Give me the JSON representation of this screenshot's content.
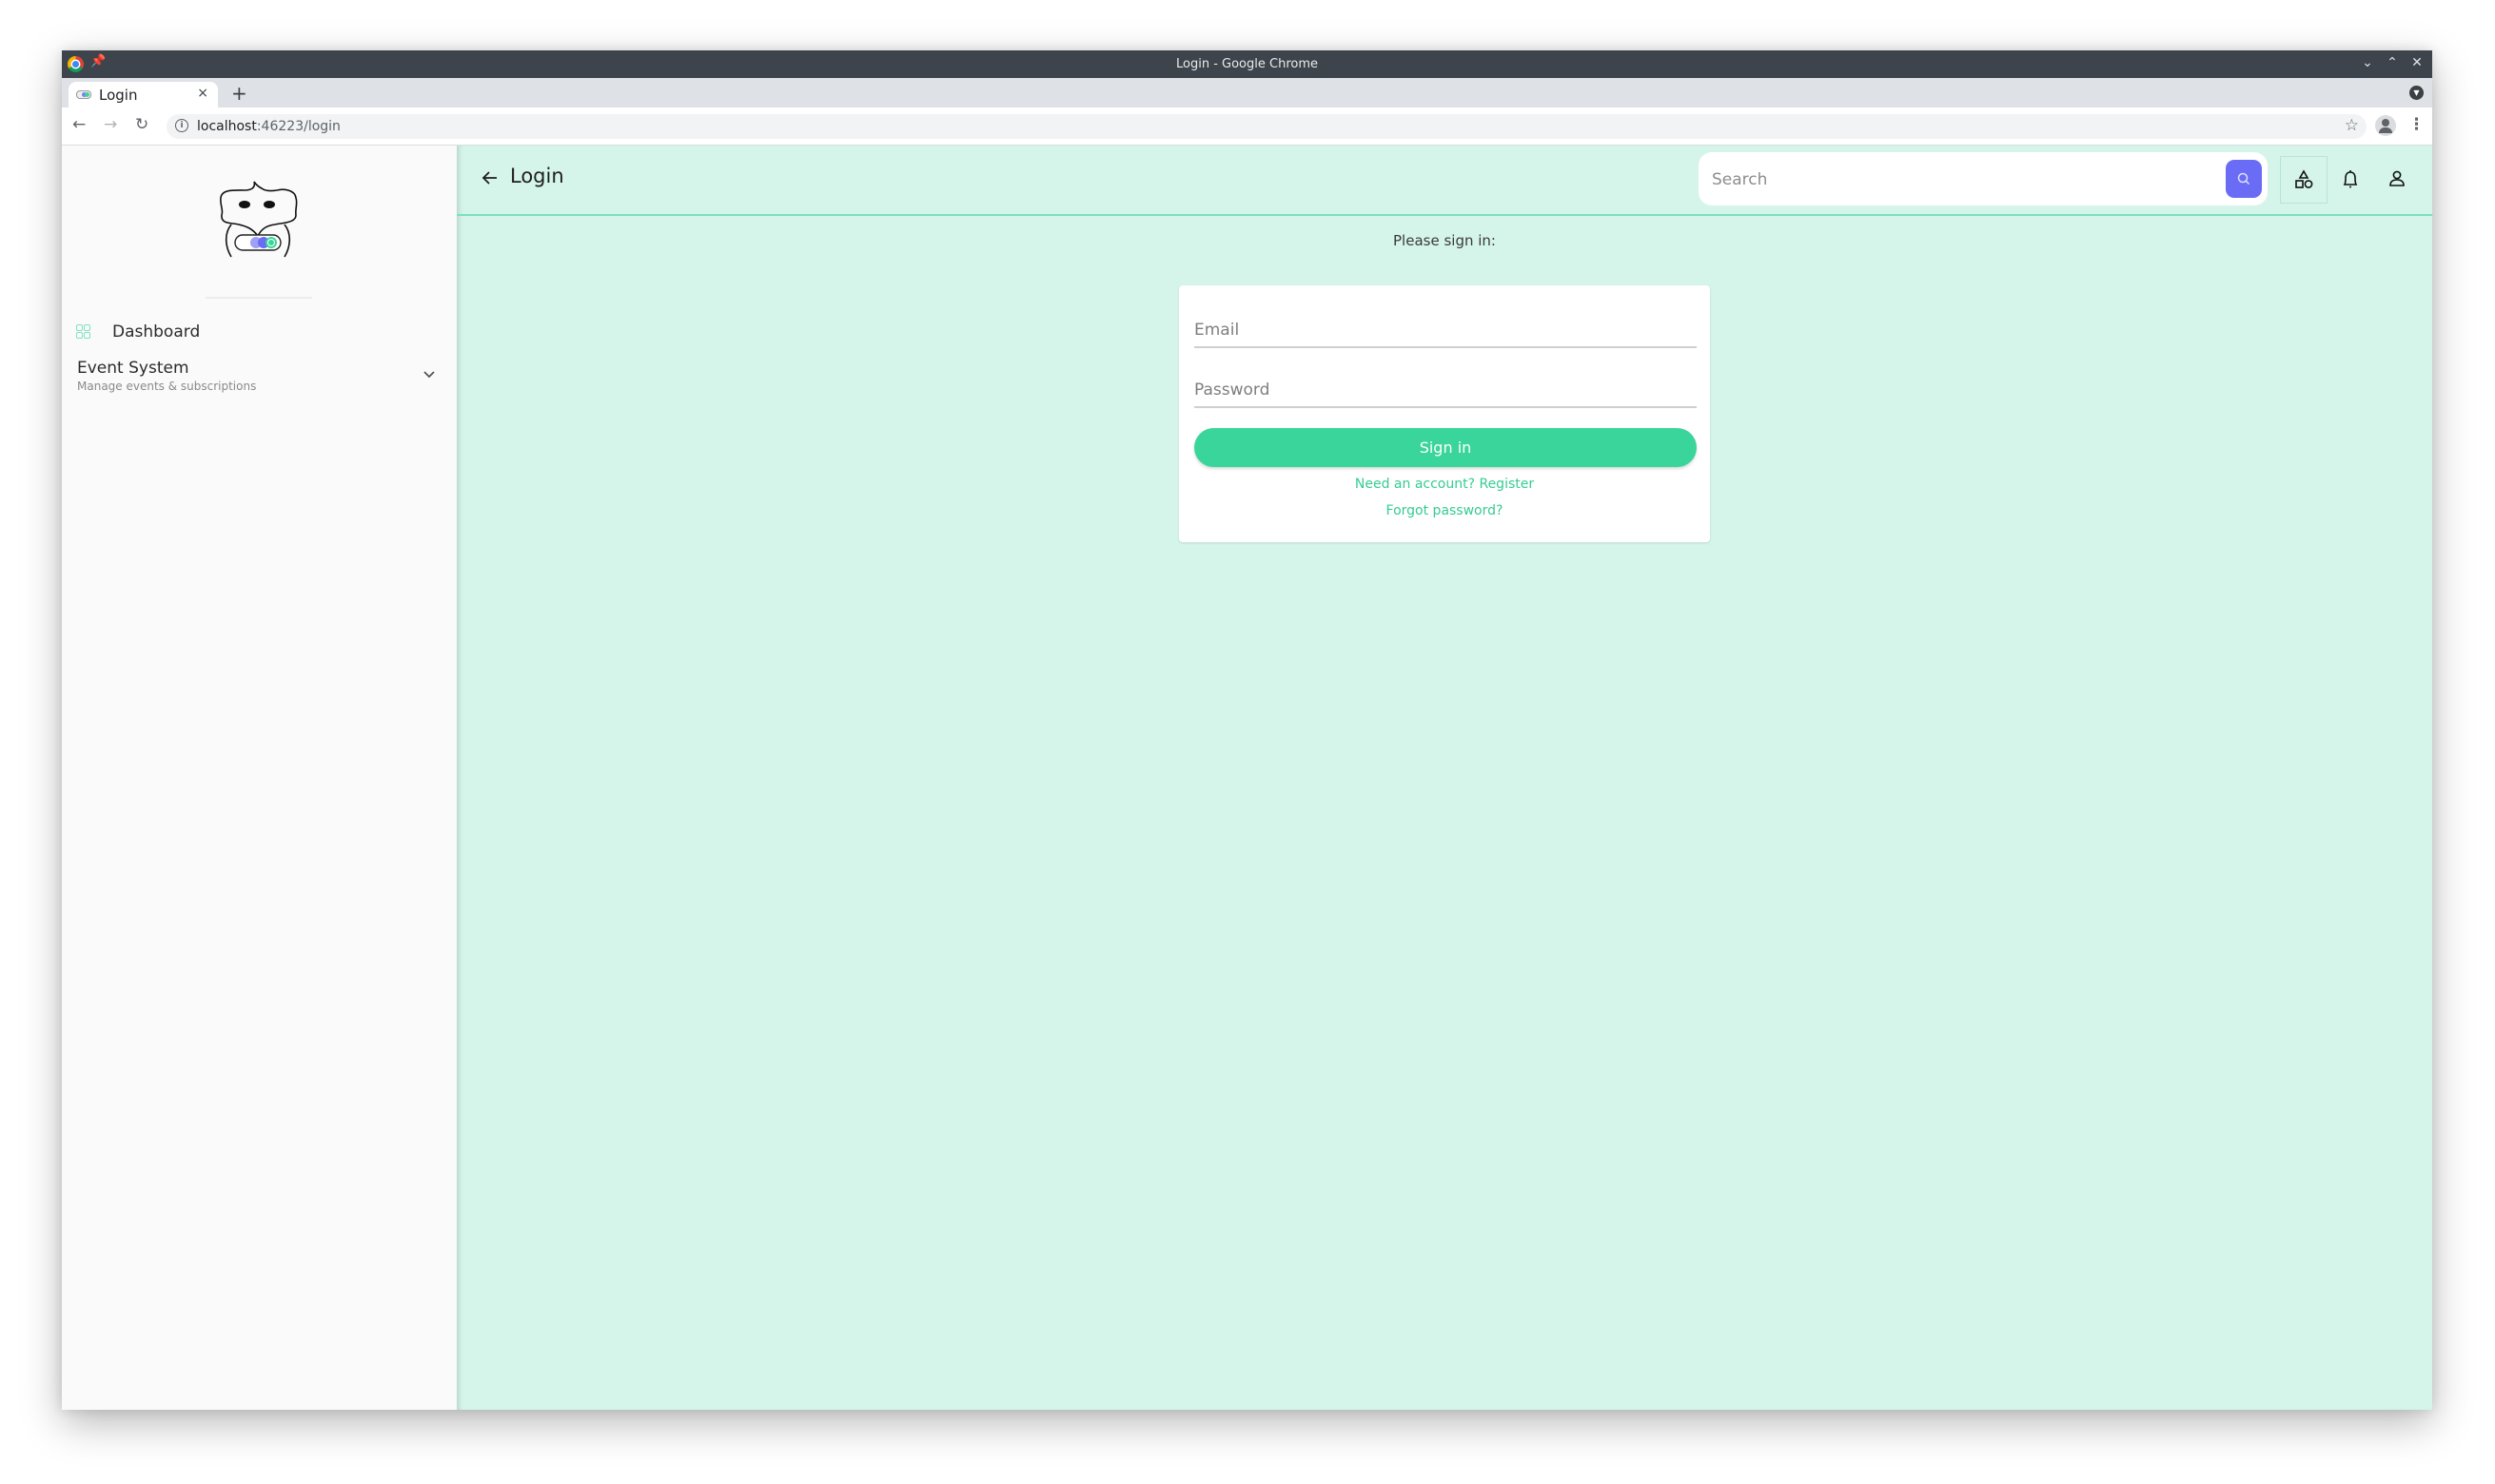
{
  "browser": {
    "window_title": "Login - Google Chrome",
    "tab": {
      "title": "Login",
      "close_glyph": "×"
    },
    "new_tab_glyph": "+",
    "address": {
      "host": "localhost",
      "path": ":46223/login"
    },
    "icons": {
      "back": "←",
      "forward": "→",
      "reload": "↻",
      "info": "i",
      "star": "☆",
      "menu": "⋮",
      "pin": "✈",
      "minimize": "⌄",
      "maximize": "⌃",
      "close": "✕",
      "tab_search": "▼"
    }
  },
  "sidebar": {
    "items": [
      {
        "label": "Dashboard",
        "icon": "grid-icon"
      },
      {
        "label": "Event System",
        "subtitle": "Manage events & subscriptions",
        "icon": "chevron-down-icon"
      }
    ]
  },
  "header": {
    "title": "Login",
    "search": {
      "placeholder": "Search",
      "value": ""
    }
  },
  "login": {
    "prompt": "Please sign in:",
    "email_placeholder": "Email",
    "password_placeholder": "Password",
    "signin_label": "Sign in",
    "register_link": "Need an account? Register",
    "forgot_link": "Forgot password?"
  },
  "colors": {
    "accent": "#3ad59a",
    "search_button": "#6a6cf6",
    "main_background": "#d5f5ea",
    "header_border": "#7ee0bd",
    "sidebar_background": "#fafafa",
    "titlebar": "#3d444c"
  }
}
